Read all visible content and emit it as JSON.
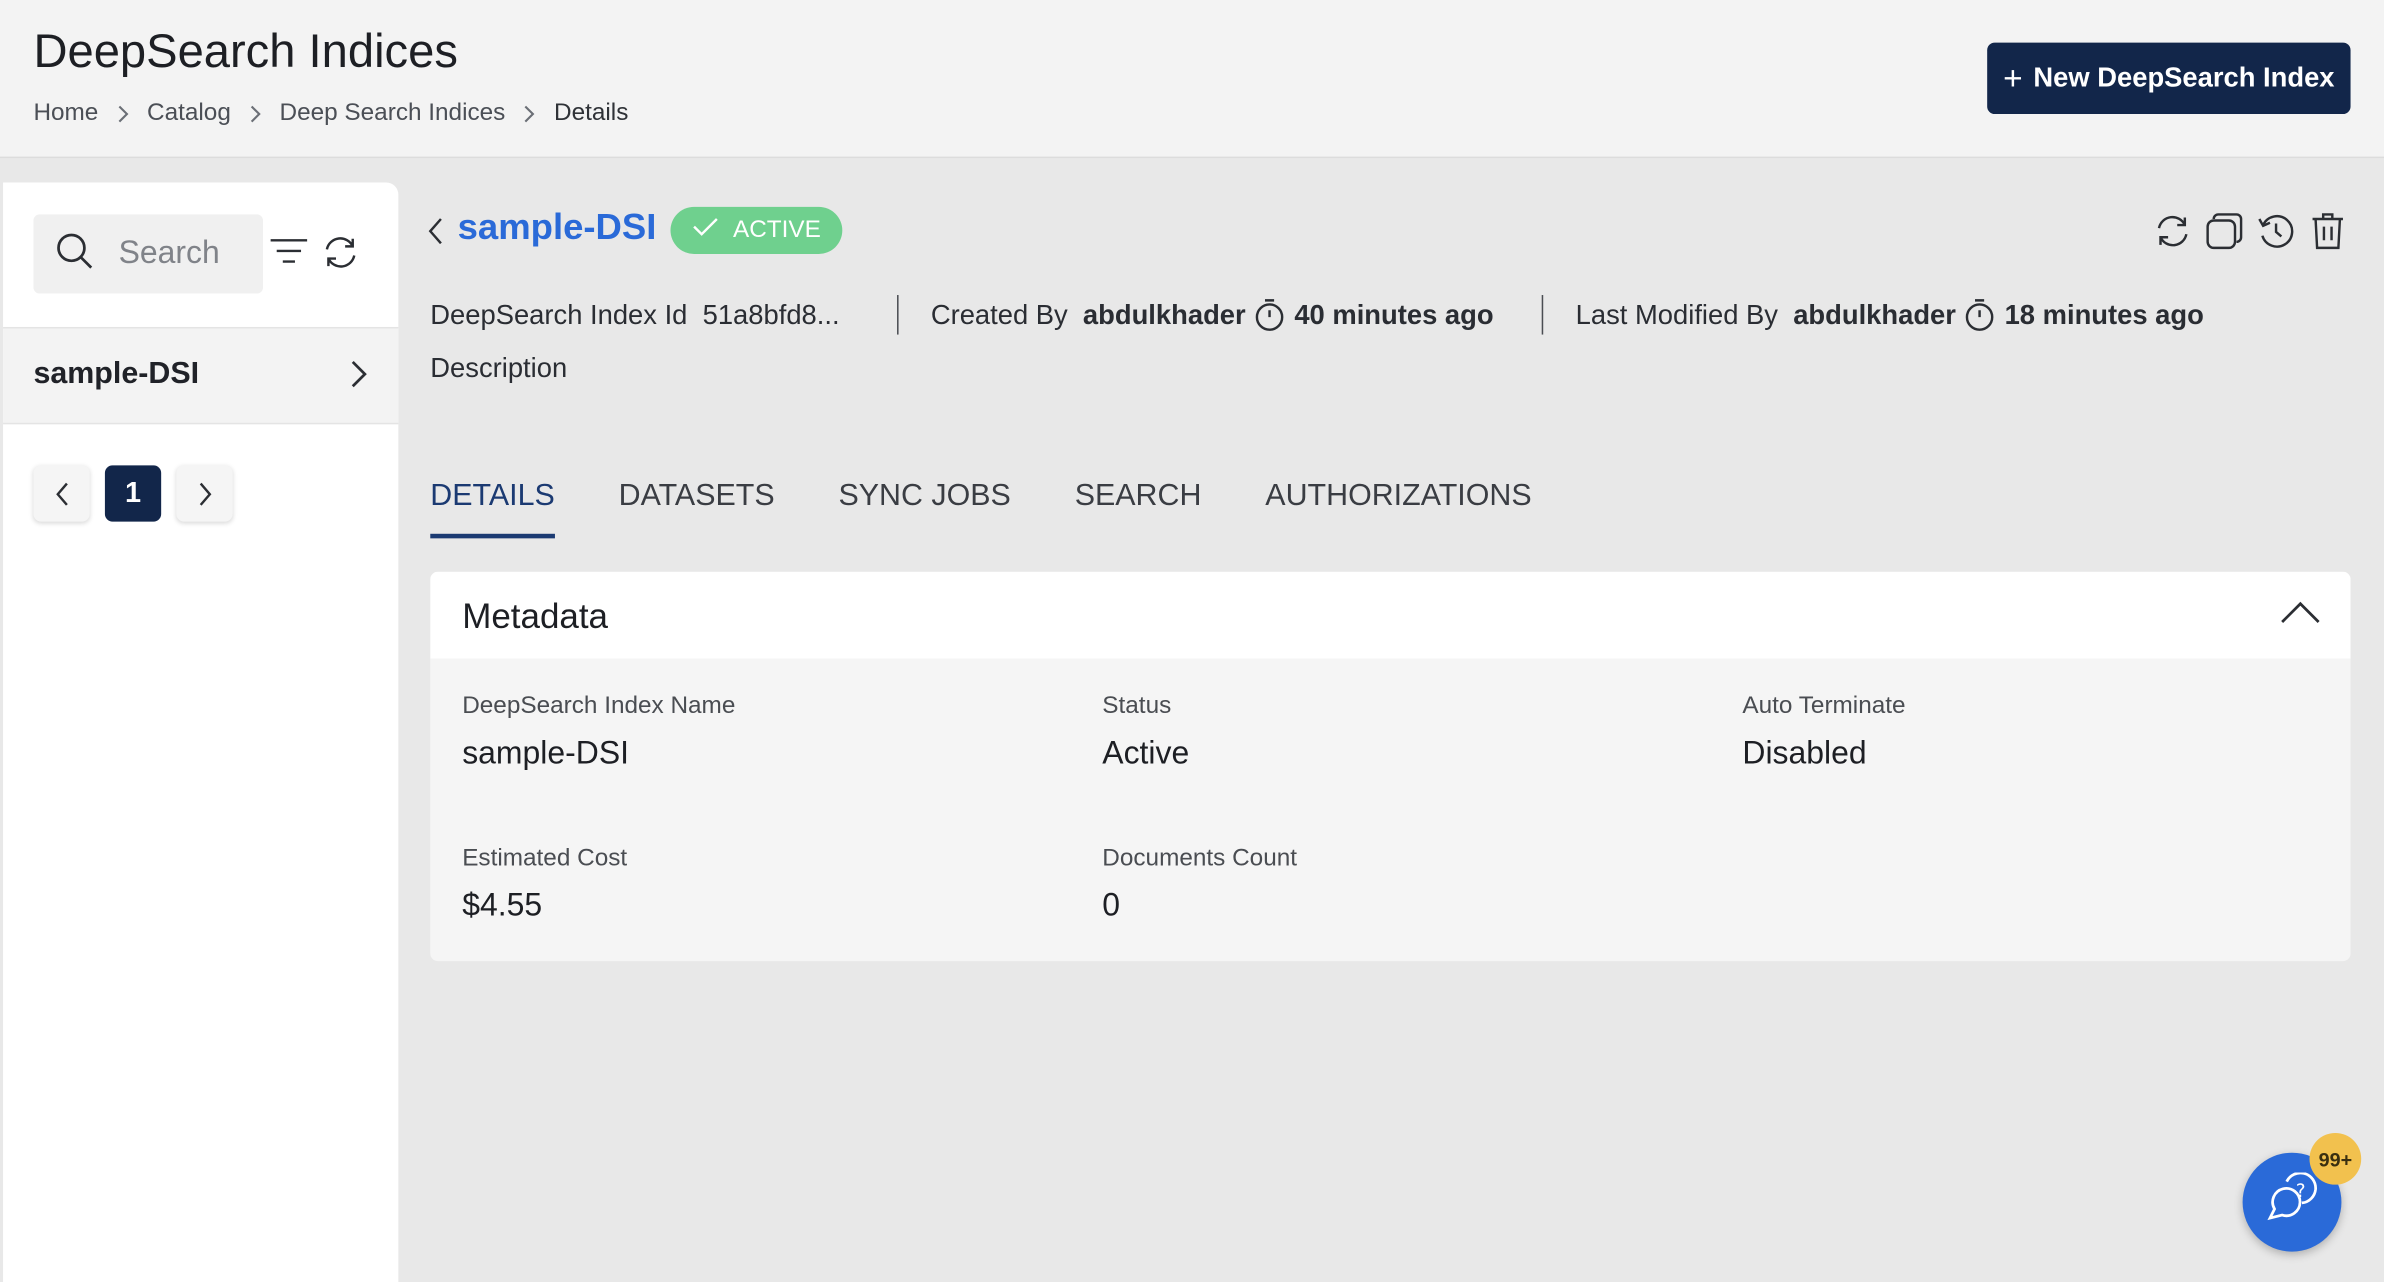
{
  "header": {
    "title": "DeepSearch Indices",
    "breadcrumb": [
      "Home",
      "Catalog",
      "Deep Search Indices",
      "Details"
    ],
    "new_button_label": "New DeepSearch Index"
  },
  "sidebar": {
    "search_placeholder": "Search",
    "items": [
      {
        "label": "sample-DSI"
      }
    ],
    "pagination": {
      "current_page": "1"
    }
  },
  "detail": {
    "name": "sample-DSI",
    "status": "ACTIVE",
    "id_label": "DeepSearch Index Id",
    "id_value": "51a8bfd8...",
    "created_by_label": "Created By",
    "created_by": "abdulkhader",
    "created_ago": "40 minutes ago",
    "modified_by_label": "Last Modified By",
    "modified_by": "abdulkhader",
    "modified_ago": "18 minutes ago",
    "description_label": "Description"
  },
  "tabs": [
    "DETAILS",
    "DATASETS",
    "SYNC JOBS",
    "SEARCH",
    "AUTHORIZATIONS"
  ],
  "metadata": {
    "title": "Metadata",
    "fields": [
      {
        "label": "DeepSearch Index Name",
        "value": "sample-DSI"
      },
      {
        "label": "Status",
        "value": "Active"
      },
      {
        "label": "Auto Terminate",
        "value": "Disabled"
      },
      {
        "label": "Estimated Cost",
        "value": "$4.55"
      },
      {
        "label": "Documents Count",
        "value": "0"
      }
    ]
  },
  "help": {
    "badge": "99+"
  },
  "colors": {
    "primary": "#12264a",
    "accent": "#2a6ad8",
    "active": "#6fd08e",
    "badge": "#f2c14e"
  }
}
